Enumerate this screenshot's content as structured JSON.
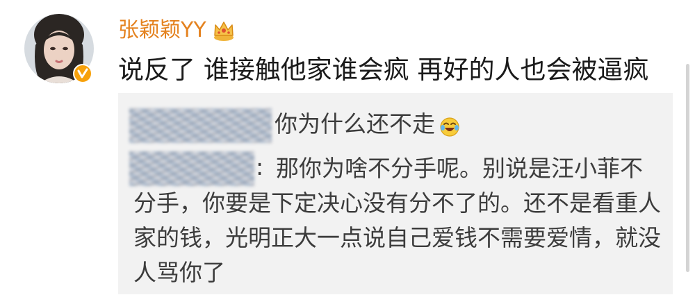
{
  "post": {
    "username": "张颖颖YY",
    "comment": "说反了 谁接触他家谁会疯 再好的人也会被逼疯"
  },
  "quote": {
    "line1": "你为什么还不走",
    "colon": ":",
    "reply": "那你为啥不分手呢。别说是汪小菲不分手，你要是下定决心没有分不了的。还不是看重人家的钱，光明正大一点说自己爱钱不需要爱情，就没人骂你了"
  },
  "icons": {
    "avatar": "avatar-photo",
    "verified": "verified-badge-icon",
    "crown": "crown-icon",
    "emoji": "laughing-crying-emoji-icon"
  },
  "colors": {
    "username": "#e4821f",
    "verified": "#f7a10b",
    "quote_background": "#f2f2f2",
    "text": "#1a1a1a"
  }
}
